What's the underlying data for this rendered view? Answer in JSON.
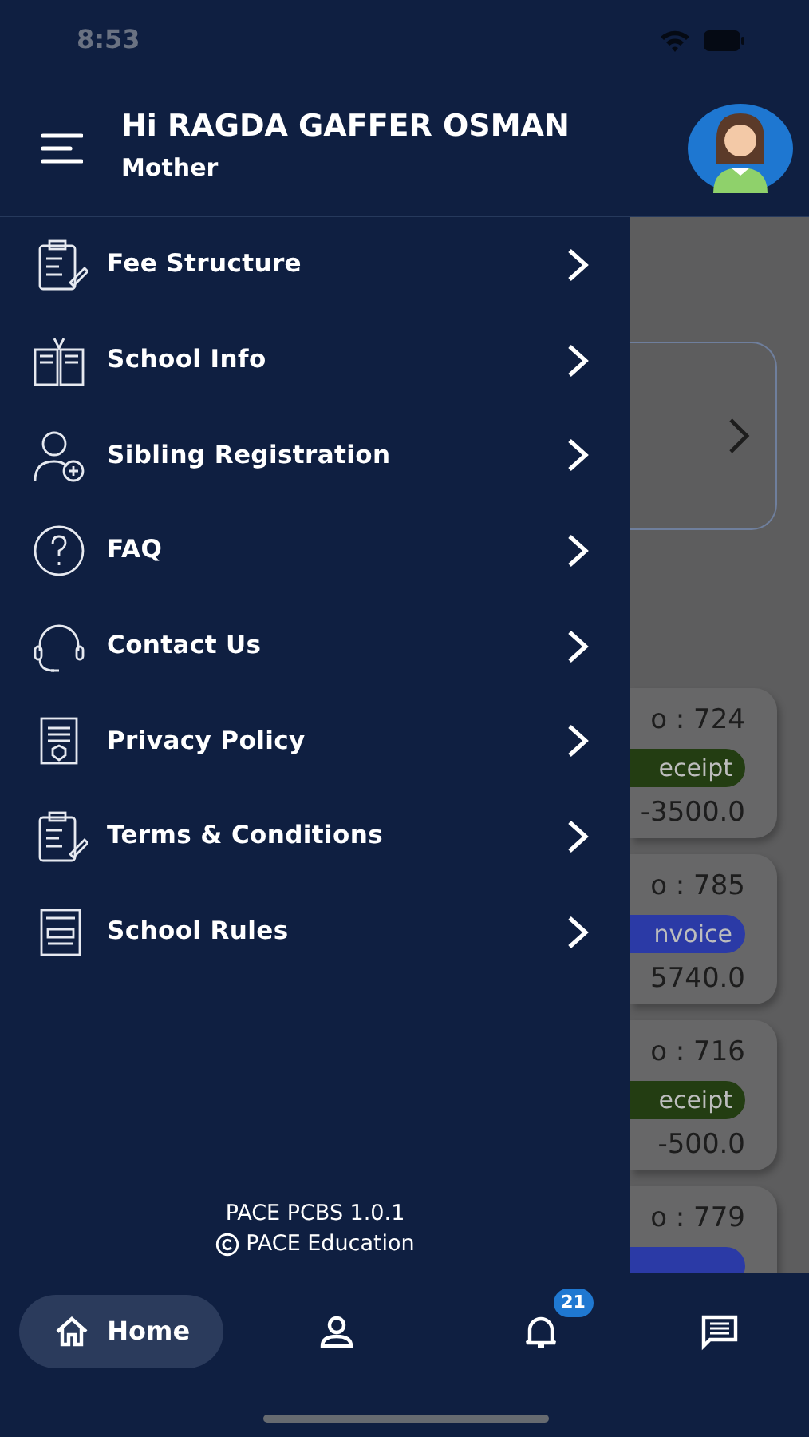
{
  "status_bar": {
    "time": "8:53"
  },
  "header": {
    "greeting": "Hi **RAGDA GAFFER OSMAN**",
    "role": "Mother"
  },
  "menu": [
    {
      "label": "Fee Structure"
    },
    {
      "label": "School Info"
    },
    {
      "label": "Sibling Registration"
    },
    {
      "label": "FAQ"
    },
    {
      "label": "Contact Us"
    },
    {
      "label": "Privacy Policy"
    },
    {
      "label": "Terms & Conditions"
    },
    {
      "label": "School Rules"
    }
  ],
  "drawer_footer": {
    "version": "PACE PCBS 1.0.1",
    "copyright": "PACE Education"
  },
  "background": {
    "transactions": [
      {
        "number": "o : 724",
        "kind": "receipt",
        "type_label": "eceipt",
        "amount": "-3500.0"
      },
      {
        "number": "o : 785",
        "kind": "invoice",
        "type_label": "nvoice",
        "amount": "5740.0"
      },
      {
        "number": "o : 716",
        "kind": "receipt",
        "type_label": "eceipt",
        "amount": "-500.0"
      },
      {
        "number": "o : 779",
        "kind": "invoice"
      }
    ]
  },
  "bottom_nav": [
    {
      "label": "Home",
      "selected": true
    },
    {
      "selected": false
    },
    {
      "selected": false,
      "badge": "21"
    },
    {
      "selected": false
    }
  ]
}
